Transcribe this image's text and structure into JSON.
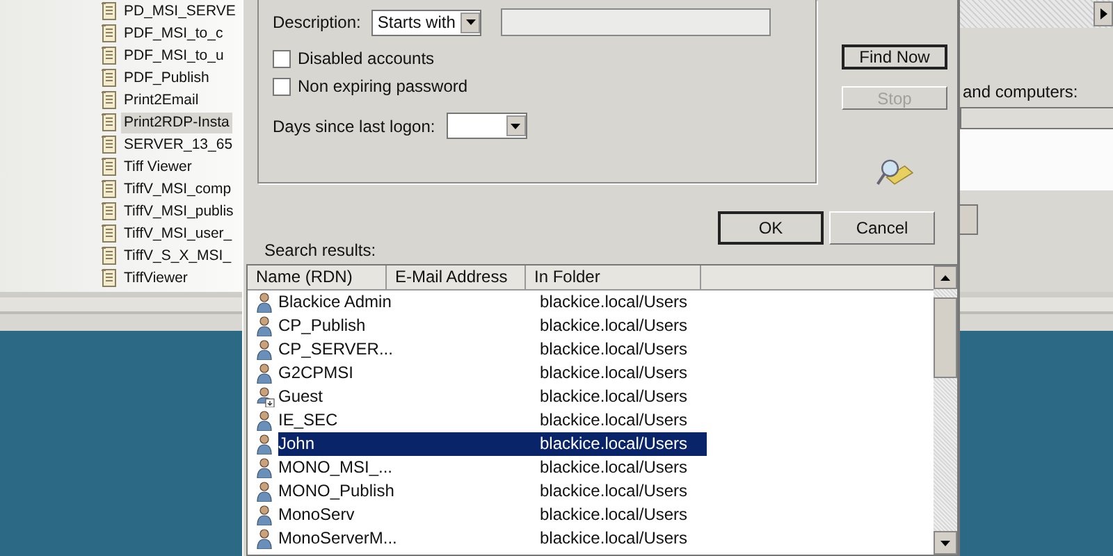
{
  "background": {
    "objects": [
      {
        "label": "PD_MSI_SERVE",
        "selected": false
      },
      {
        "label": "PDF_MSI_to_c",
        "selected": false
      },
      {
        "label": "PDF_MSI_to_u",
        "selected": false
      },
      {
        "label": "PDF_Publish",
        "selected": false
      },
      {
        "label": "Print2Email",
        "selected": false
      },
      {
        "label": "Print2RDP-Insta",
        "selected": true
      },
      {
        "label": "SERVER_13_65",
        "selected": false
      },
      {
        "label": "Tiff Viewer",
        "selected": false
      },
      {
        "label": "TiffV_MSI_comp",
        "selected": false
      },
      {
        "label": "TiffV_MSI_publis",
        "selected": false
      },
      {
        "label": "TiffV_MSI_user_",
        "selected": false
      },
      {
        "label": "TiffV_S_X_MSI_",
        "selected": false
      },
      {
        "label": "TiffViewer",
        "selected": false
      }
    ],
    "right_pane": {
      "label": "and computers:"
    }
  },
  "dialog": {
    "description": {
      "label": "Description:",
      "mode": "Starts with"
    },
    "checkboxes": [
      {
        "label": "Disabled accounts",
        "checked": false
      },
      {
        "label": "Non expiring password",
        "checked": false
      }
    ],
    "days": {
      "label": "Days since last logon:"
    },
    "side_buttons": [
      {
        "label": "Find Now",
        "default": true,
        "disabled": false
      },
      {
        "label": "Stop",
        "default": false,
        "disabled": true
      }
    ],
    "buttons": [
      {
        "label": "OK",
        "default": true,
        "disabled": false
      },
      {
        "label": "Cancel",
        "default": false,
        "disabled": false
      }
    ],
    "results": {
      "label": "Search results:",
      "columns": [
        "Name (RDN)",
        "E-Mail Address",
        "In Folder"
      ],
      "rows": [
        {
          "name": "Blackice Admin",
          "folder": "blackice.local/Users",
          "kind": "user",
          "selected": false
        },
        {
          "name": "CP_Publish",
          "folder": "blackice.local/Users",
          "kind": "user",
          "selected": false
        },
        {
          "name": "CP_SERVER...",
          "folder": "blackice.local/Users",
          "kind": "user",
          "selected": false
        },
        {
          "name": "G2CPMSI",
          "folder": "blackice.local/Users",
          "kind": "user",
          "selected": false
        },
        {
          "name": "Guest",
          "folder": "blackice.local/Users",
          "kind": "guest",
          "selected": false
        },
        {
          "name": "IE_SEC",
          "folder": "blackice.local/Users",
          "kind": "user",
          "selected": false
        },
        {
          "name": "John",
          "folder": "blackice.local/Users",
          "kind": "user",
          "selected": true
        },
        {
          "name": "MONO_MSI_...",
          "folder": "blackice.local/Users",
          "kind": "user",
          "selected": false
        },
        {
          "name": "MONO_Publish",
          "folder": "blackice.local/Users",
          "kind": "user",
          "selected": false
        },
        {
          "name": "MonoServ",
          "folder": "blackice.local/Users",
          "kind": "user",
          "selected": false
        },
        {
          "name": "MonoServerM...",
          "folder": "blackice.local/Users",
          "kind": "user",
          "selected": false
        }
      ]
    }
  }
}
